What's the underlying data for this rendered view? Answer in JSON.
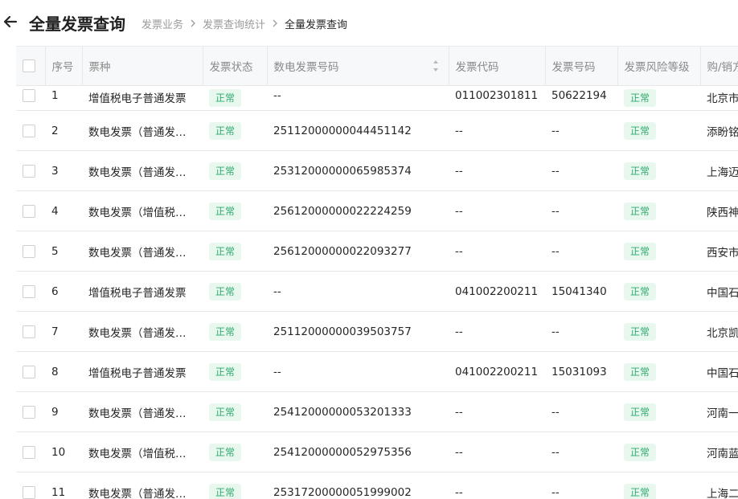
{
  "header": {
    "title": "全量发票查询",
    "breadcrumbs": [
      "发票业务",
      "发票查询统计",
      "全量发票查询"
    ]
  },
  "icons": {
    "back": "arrow-left-icon",
    "separator": "chevron-right-icon",
    "sort": "sort-icon"
  },
  "colors": {
    "badge_bg": "#e8f8ef",
    "badge_text": "#2eaa6b",
    "header_bg": "#f7f8fa"
  },
  "table": {
    "columns": [
      "序号",
      "票种",
      "发票状态",
      "数电发票号码",
      "发票代码",
      "发票号码",
      "发票风险等级",
      "购/销方"
    ],
    "rows": [
      {
        "no": "1",
        "type": "增值税电子普通发票",
        "status": "正常",
        "digital_no": "--",
        "code": "011002301811",
        "number": "50622194",
        "risk": "正常",
        "party": "北京市"
      },
      {
        "no": "2",
        "type": "数电发票（普通发…",
        "status": "正常",
        "digital_no": "25112000000044451142",
        "code": "--",
        "number": "--",
        "risk": "正常",
        "party": "添盼铭"
      },
      {
        "no": "3",
        "type": "数电发票（普通发…",
        "status": "正常",
        "digital_no": "25312000000065985374",
        "code": "--",
        "number": "--",
        "risk": "正常",
        "party": "上海迈"
      },
      {
        "no": "4",
        "type": "数电发票（增值税…",
        "status": "正常",
        "digital_no": "25612000000022224259",
        "code": "--",
        "number": "--",
        "risk": "正常",
        "party": "陕西神"
      },
      {
        "no": "5",
        "type": "数电发票（普通发…",
        "status": "正常",
        "digital_no": "25612000000022093277",
        "code": "--",
        "number": "--",
        "risk": "正常",
        "party": "西安市"
      },
      {
        "no": "6",
        "type": "增值税电子普通发票",
        "status": "正常",
        "digital_no": "--",
        "code": "041002200211",
        "number": "15041340",
        "risk": "正常",
        "party": "中国石"
      },
      {
        "no": "7",
        "type": "数电发票（普通发…",
        "status": "正常",
        "digital_no": "25112000000039503757",
        "code": "--",
        "number": "--",
        "risk": "正常",
        "party": "北京凯"
      },
      {
        "no": "8",
        "type": "增值税电子普通发票",
        "status": "正常",
        "digital_no": "--",
        "code": "041002200211",
        "number": "15031093",
        "risk": "正常",
        "party": "中国石"
      },
      {
        "no": "9",
        "type": "数电发票（普通发…",
        "status": "正常",
        "digital_no": "25412000000053201333",
        "code": "--",
        "number": "--",
        "risk": "正常",
        "party": "河南一"
      },
      {
        "no": "10",
        "type": "数电发票（增值税…",
        "status": "正常",
        "digital_no": "25412000000052975356",
        "code": "--",
        "number": "--",
        "risk": "正常",
        "party": "河南蓝"
      },
      {
        "no": "11",
        "type": "数电发票（普通发…",
        "status": "正常",
        "digital_no": "25317200000051999002",
        "code": "--",
        "number": "--",
        "risk": "正常",
        "party": "上海二"
      }
    ]
  }
}
